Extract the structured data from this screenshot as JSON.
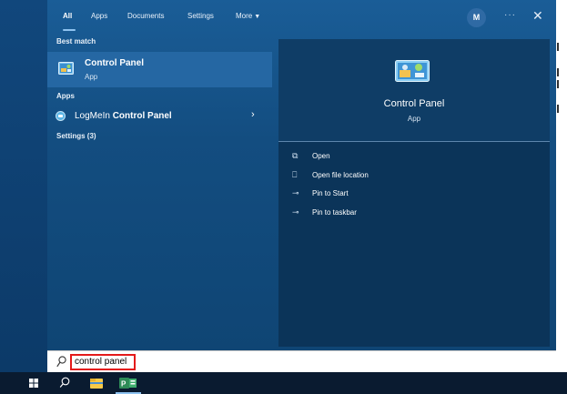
{
  "tabs": [
    {
      "label": "All",
      "active": true
    },
    {
      "label": "Apps",
      "active": false
    },
    {
      "label": "Documents",
      "active": false
    },
    {
      "label": "Settings",
      "active": false
    },
    {
      "label": "More",
      "active": false
    }
  ],
  "header": {
    "avatar_initial": "M",
    "more_options": "···",
    "close": "✕"
  },
  "results": {
    "best_match_heading": "Best match",
    "best_match": {
      "name": "Control Panel",
      "type": "App",
      "icon": "control-panel-icon"
    },
    "apps_heading": "Apps",
    "apps": [
      {
        "prefix": "LogMeIn ",
        "highlight": "Control Panel",
        "icon": "logmein-icon",
        "chevron": "›"
      }
    ],
    "settings_heading": "Settings (3)"
  },
  "preview": {
    "title": "Control Panel",
    "subtitle": "App",
    "actions": [
      {
        "label": "Open",
        "icon": "open-icon"
      },
      {
        "label": "Open file location",
        "icon": "file-location-icon"
      },
      {
        "label": "Pin to Start",
        "icon": "pin-icon"
      },
      {
        "label": "Pin to taskbar",
        "icon": "pin-icon"
      }
    ]
  },
  "search": {
    "value": "control panel",
    "highlight_color": "#e41a1a"
  },
  "taskbar": {
    "items": [
      "windows-start-icon",
      "search-icon",
      "file-explorer-icon",
      "project-app-icon"
    ]
  },
  "colors": {
    "menu_bg": "#1a5d97",
    "selected_row": "#2567a3",
    "preview_bg": "#0b3459",
    "taskbar_bg": "#0a1b30"
  }
}
